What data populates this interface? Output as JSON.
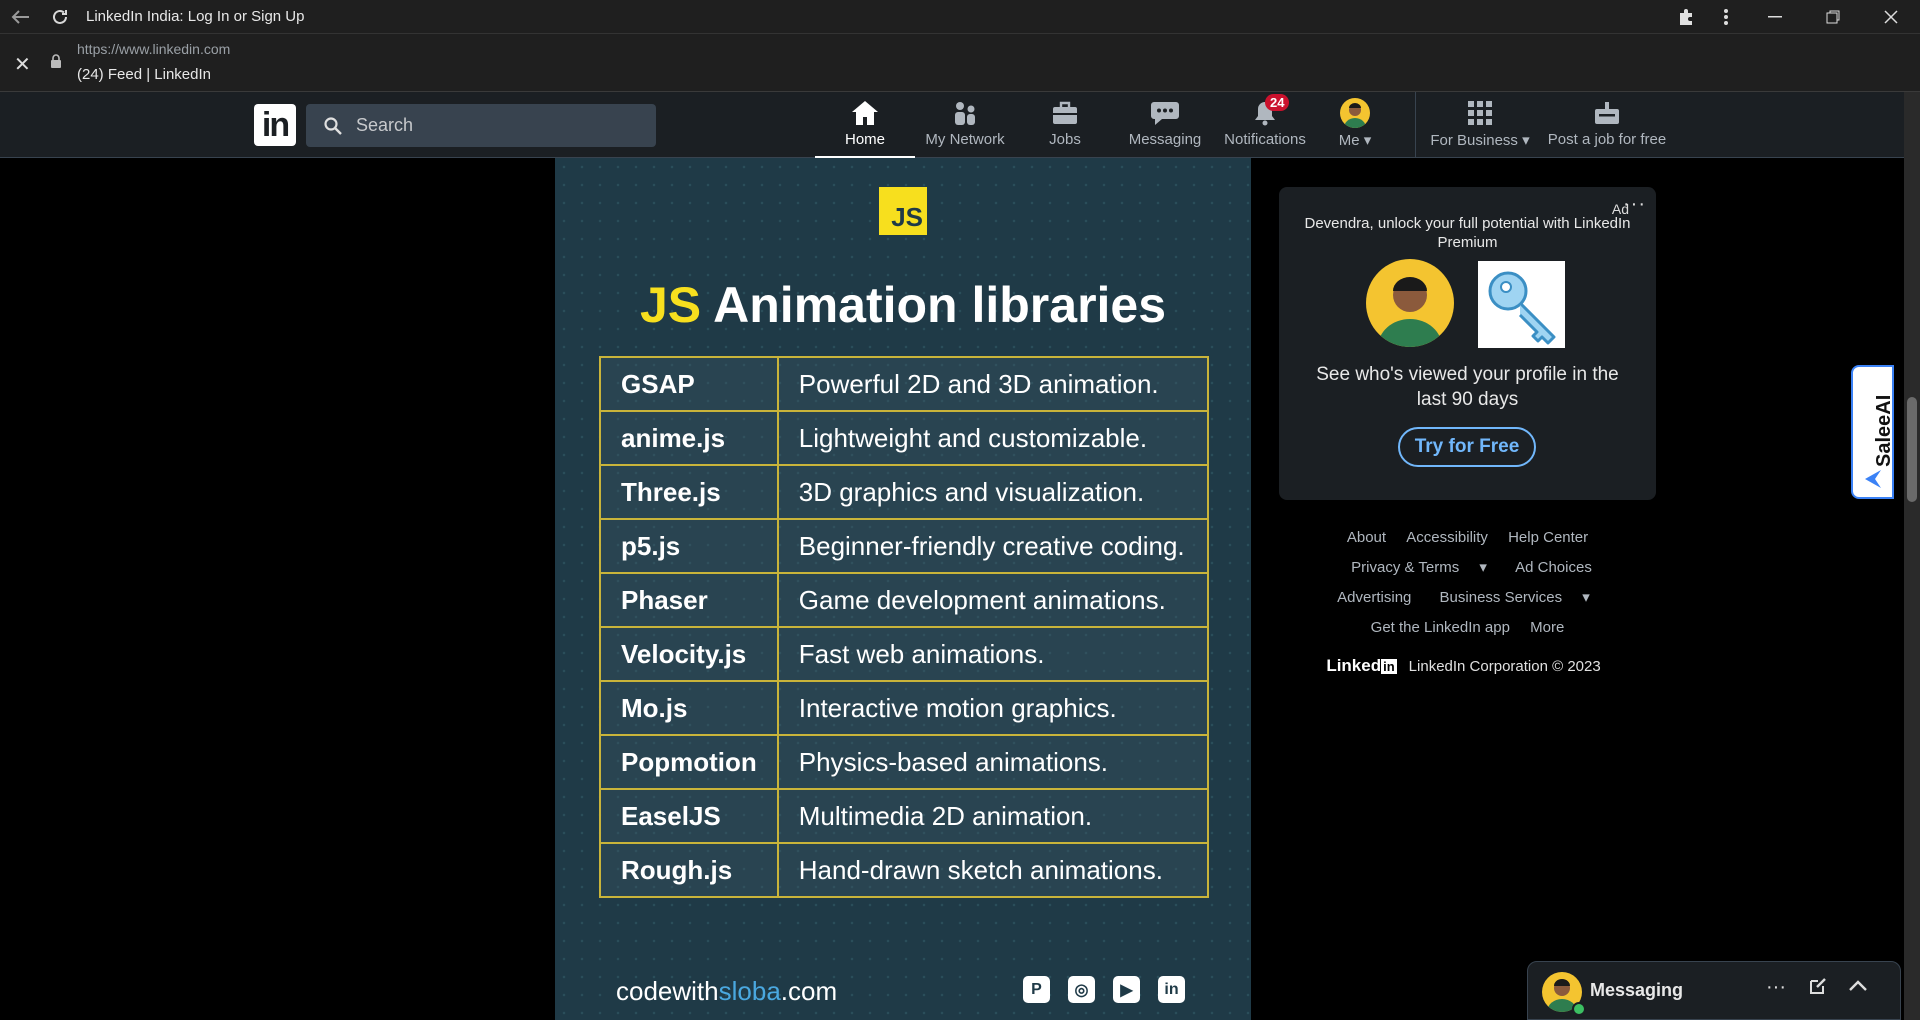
{
  "browser": {
    "window_title": "LinkedIn India: Log In or Sign Up",
    "url": "https://www.linkedin.com",
    "page_title": "(24) Feed | LinkedIn"
  },
  "nav": {
    "logo": "in",
    "search_placeholder": "Search",
    "items": [
      {
        "label": "Home",
        "icon": "home-icon"
      },
      {
        "label": "My Network",
        "icon": "network-icon"
      },
      {
        "label": "Jobs",
        "icon": "briefcase-icon"
      },
      {
        "label": "Messaging",
        "icon": "chat-icon"
      },
      {
        "label": "Notifications",
        "icon": "bell-icon",
        "badge": "24"
      },
      {
        "label": "Me",
        "icon": "avatar"
      },
      {
        "label": "For Business",
        "icon": "grid-icon"
      },
      {
        "label": "Post a job for free",
        "icon": "job-post-icon"
      }
    ]
  },
  "post": {
    "badge": "JS",
    "heading_highlight": "JS",
    "heading_rest": "Animation libraries",
    "rows": [
      {
        "name": "GSAP",
        "desc": "Powerful 2D and 3D animation."
      },
      {
        "name": "anime.js",
        "desc": "Lightweight and customizable."
      },
      {
        "name": "Three.js",
        "desc": "3D graphics and visualization."
      },
      {
        "name": "p5.js",
        "desc": "Beginner-friendly creative coding."
      },
      {
        "name": "Phaser",
        "desc": "Game development animations."
      },
      {
        "name": "Velocity.js",
        "desc": "Fast web animations."
      },
      {
        "name": "Mo.js",
        "desc": "Interactive motion graphics."
      },
      {
        "name": "Popmotion",
        "desc": "Physics-based animations."
      },
      {
        "name": "EaselJS",
        "desc": "Multimedia 2D animation."
      },
      {
        "name": "Rough.js",
        "desc": "Hand-drawn sketch animations."
      }
    ],
    "footer_a": "codewith",
    "footer_b": "sloba",
    "footer_c": ".com"
  },
  "ad": {
    "label": "Ad",
    "headline": "Devendra, unlock your full potential with LinkedIn Premium",
    "body": "See who's viewed your profile in the last 90 days",
    "cta": "Try for Free"
  },
  "footer": {
    "links": [
      "About",
      "Accessibility",
      "Help Center",
      "Privacy & Terms",
      "Ad Choices",
      "Advertising",
      "Business Services",
      "Get the LinkedIn app",
      "More"
    ],
    "brand": "Linked",
    "copyright": "LinkedIn Corporation © 2023"
  },
  "salee": {
    "label": "SaleeAI"
  },
  "messaging": {
    "label": "Messaging"
  }
}
